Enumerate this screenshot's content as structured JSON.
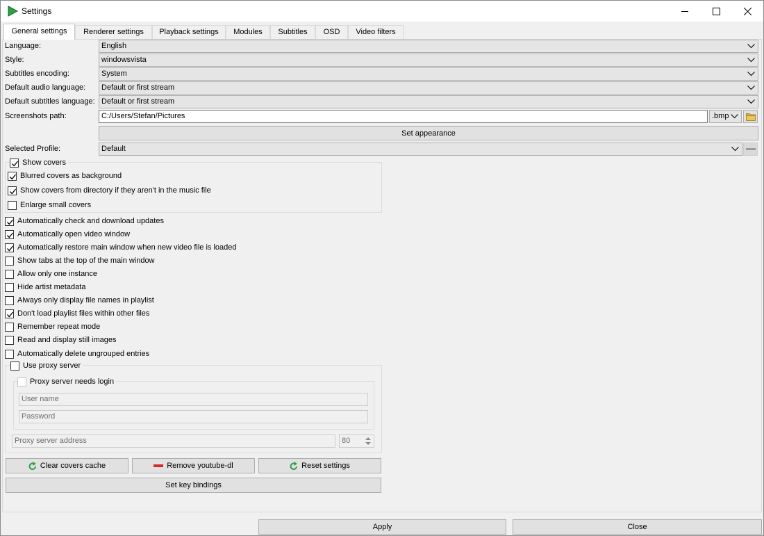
{
  "window": {
    "title": "Settings"
  },
  "tabs": [
    {
      "label": "General settings",
      "active": true
    },
    {
      "label": "Renderer settings"
    },
    {
      "label": "Playback settings"
    },
    {
      "label": "Modules"
    },
    {
      "label": "Subtitles"
    },
    {
      "label": "OSD"
    },
    {
      "label": "Video filters"
    }
  ],
  "general": {
    "language": {
      "label": "Language:",
      "value": "English"
    },
    "style": {
      "label": "Style:",
      "value": "windowsvista"
    },
    "subtitles_encoding": {
      "label": "Subtitles encoding:",
      "value": "System"
    },
    "default_audio_language": {
      "label": "Default audio language:",
      "value": "Default or first stream"
    },
    "default_subtitles_language": {
      "label": "Default subtitles language:",
      "value": "Default or first stream"
    },
    "screenshots": {
      "label": "Screenshots path:",
      "path": "C:/Users/Stefan/Pictures",
      "format": ".bmp"
    },
    "set_appearance_label": "Set appearance",
    "profile": {
      "label": "Selected Profile:",
      "value": "Default"
    }
  },
  "covers": {
    "show_covers": {
      "label": "Show covers",
      "checked": true
    },
    "blurred": {
      "label": "Blurred covers as background",
      "checked": true
    },
    "from_directory": {
      "label": "Show covers from directory if they aren't in the music file",
      "checked": true
    },
    "enlarge": {
      "label": "Enlarge small covers",
      "checked": false
    }
  },
  "options": [
    {
      "label": "Automatically check and download updates",
      "checked": true
    },
    {
      "label": "Automatically open video window",
      "checked": true
    },
    {
      "label": "Automatically restore main window when new video file is loaded",
      "checked": true
    },
    {
      "label": "Show tabs at the top of the main window",
      "checked": false
    },
    {
      "label": "Allow only one instance",
      "checked": false
    },
    {
      "label": "Hide artist metadata",
      "checked": false
    },
    {
      "label": "Always only display file names in playlist",
      "checked": false
    },
    {
      "label": "Don't load playlist files within other files",
      "checked": true
    },
    {
      "label": "Remember repeat mode",
      "checked": false
    },
    {
      "label": "Read and display still images",
      "checked": false
    },
    {
      "label": "Automatically delete ungrouped entries",
      "checked": false
    }
  ],
  "proxy": {
    "use_proxy": {
      "label": "Use proxy server",
      "checked": false
    },
    "needs_login": {
      "label": "Proxy server needs login",
      "checked": false
    },
    "username_placeholder": "User name",
    "password_placeholder": "Password",
    "address_placeholder": "Proxy server address",
    "port": "80"
  },
  "buttons": {
    "clear_covers_cache": "Clear covers cache",
    "remove_youtube_dl": "Remove youtube-dl",
    "reset_settings": "Reset settings",
    "set_key_bindings": "Set key bindings",
    "apply": "Apply",
    "close": "Close"
  },
  "colors": {
    "accent_green": "#2ea043",
    "remove_red": "#d42a2a",
    "folder_yellow": "#dcb43c"
  }
}
